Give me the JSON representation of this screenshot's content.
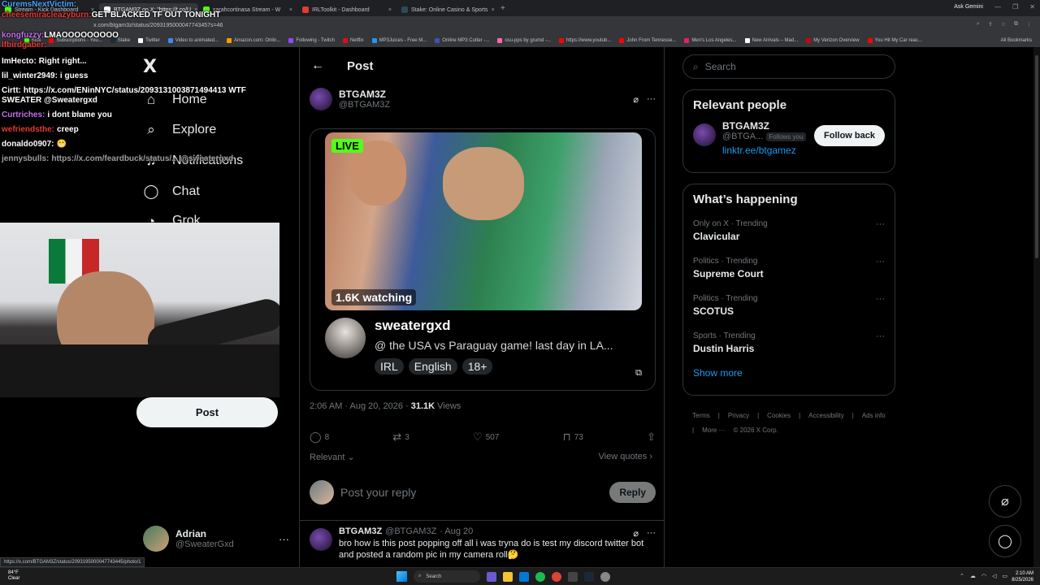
{
  "browser": {
    "tabs": [
      {
        "label": "Stream - Kick Dashboard",
        "color": "#53fc18",
        "active": false
      },
      {
        "label": "BTGAM3Z on X: \"https://t.co/U",
        "color": "#ffffff",
        "active": true
      },
      {
        "label": "sarahcortinasa Stream - W",
        "color": "#53fc18",
        "active": false
      },
      {
        "label": "IRLToolkit - Dashboard",
        "color": "#e53935",
        "active": false
      },
      {
        "label": "Stake: Online Casino & Sports",
        "color": "#1a2c38",
        "active": false
      }
    ],
    "new_tab": "+",
    "ask_gemini": "Ask Gemini",
    "url": "x.com/btgam3z/status/2093195000047743457s=46",
    "bookmarks": [
      {
        "label": "Kick",
        "color": "#53fc18"
      },
      {
        "label": "Subscriptions - You...",
        "color": "#ff0000"
      },
      {
        "label": "Stake",
        "color": "#1a2c38"
      },
      {
        "label": "Twitter",
        "color": "#ffffff"
      },
      {
        "label": "Video to animated...",
        "color": "#4285f4"
      },
      {
        "label": "Amazon.com: Onlin...",
        "color": "#ff9900"
      },
      {
        "label": "Following - Twitch",
        "color": "#9146ff"
      },
      {
        "label": "Netflix",
        "color": "#e50914"
      },
      {
        "label": "MP3Juices - Free M...",
        "color": "#2196f3"
      },
      {
        "label": "Online MP3 Cutter -...",
        "color": "#3f51b5"
      },
      {
        "label": "osu-pps by grumd -...",
        "color": "#ff66aa"
      },
      {
        "label": "https://www.youtub...",
        "color": "#ff0000"
      },
      {
        "label": "John From Tennesse...",
        "color": "#ff0000"
      },
      {
        "label": "Men's Los Angeles...",
        "color": "#e91e63"
      },
      {
        "label": "New Arrivals – Mad...",
        "color": "#ffffff"
      },
      {
        "label": "My Verizon Overview",
        "color": "#cd040b"
      },
      {
        "label": "You Hit My Car reac...",
        "color": "#ff0000"
      }
    ],
    "all_bookmarks": "All Bookmarks",
    "status_url": "https://x.com/BTGAM3Z/status/2093195000047743445/photo/1"
  },
  "nav": {
    "logo": "X",
    "items": [
      {
        "label": "Home",
        "icon": "home-icon",
        "glyph": "⌂"
      },
      {
        "label": "Explore",
        "icon": "search-icon",
        "glyph": "⌕"
      },
      {
        "label": "Notifications",
        "icon": "bell-icon",
        "glyph": "♫"
      },
      {
        "label": "Chat",
        "icon": "chat-icon",
        "glyph": "◯"
      },
      {
        "label": "Grok",
        "icon": "grok-icon",
        "glyph": "◔"
      }
    ],
    "post_button": "Post",
    "account": {
      "name": "Adrian",
      "handle": "@SweaterGxd",
      "more": "···"
    }
  },
  "post": {
    "header": "Post",
    "back": "←",
    "author": {
      "name": "BTGAM3Z",
      "handle": "@BTGAM3Z",
      "more": "···"
    },
    "card": {
      "live": "LIVE",
      "watching": "1.6K watching",
      "streamer": "sweatergxd",
      "title": "@ the USA vs Paraguay game! last day in LA...",
      "tags": [
        "IRL",
        "English",
        "18+"
      ]
    },
    "meta": {
      "time": "2:06 AM · Aug 20, 2026 · ",
      "views_count": "31.1K",
      "views_label": " Views"
    },
    "stats": {
      "replies": "8",
      "reposts": "3",
      "likes": "507",
      "bookmarks": "73"
    },
    "sort": "Relevant ⌄",
    "view_quotes": "View quotes ›",
    "reply_placeholder": "Post your reply",
    "reply_button": "Reply",
    "reply_post": {
      "name": "BTGAM3Z",
      "handle": "@BTGAM3Z",
      "date": "· Aug 20",
      "text": "bro how is this post popping off all i was tryna do is test my discord twitter bot and posted a random pic in my camera roll🤔"
    }
  },
  "sidebar": {
    "search_placeholder": "Search",
    "relevant": {
      "title": "Relevant people",
      "name": "BTGAM3Z",
      "handle": "@BTGA...",
      "follows_you": "Follows you",
      "link": "linktr.ee/btgamez",
      "button": "Follow back"
    },
    "happening": {
      "title": "What’s happening",
      "trends": [
        {
          "context": "Only on X · Trending",
          "topic": "Clavicular"
        },
        {
          "context": "Politics · Trending",
          "topic": "Supreme Court"
        },
        {
          "context": "Politics · Trending",
          "topic": "SCOTUS"
        },
        {
          "context": "Sports · Trending",
          "topic": "Dustin Harris"
        }
      ],
      "show_more": "Show more"
    },
    "footer": [
      "Terms",
      "|",
      "Privacy",
      "|",
      "Cookies",
      "|",
      "Accessibility",
      "|",
      "Ads info",
      "|",
      "More ···",
      "© 2026 X Corp."
    ]
  },
  "chat_overlay": {
    "top_lines": [
      {
        "user": "CuremsNextVictim:",
        "text": "",
        "color": "#4aa3ff"
      },
      {
        "user": "cheesemiracleazyburn:",
        "text": "GET BLACKED TF OUT TONIGHT",
        "color": "#e53935"
      },
      {
        "user": "",
        "text": "",
        "color": "#ffffff"
      },
      {
        "user": "kongfuzzy:",
        "text": "LMAOOOOOOOOO",
        "color": "#c471ed"
      },
      {
        "user": "lfbirdgaber:",
        "text": "",
        "color": "#e53935"
      }
    ],
    "messages": [
      {
        "user": "ImHecto:",
        "text": "Right right...",
        "color": "#ffffff"
      },
      {
        "user": "lil_winter2949:",
        "text": "i guess",
        "color": "#ffffff"
      },
      {
        "user": "Cirtt:",
        "text": "https://x.com/ENinNYC/status/2093131003871494413 WTF SWEATER @Sweatergxd",
        "color": "#ffffff"
      },
      {
        "user": "Curtriches:",
        "text": "i dont blame you",
        "color": "#c471ed"
      },
      {
        "user": "wefriendsthe:",
        "text": "creep",
        "color": "#e53935"
      },
      {
        "user": "donaldo0907:",
        "text": "😬",
        "color": "#ffffff"
      },
      {
        "user": "jennysbulls:",
        "text": "https://x.com/feardbuck/status/... @sweatergxd",
        "color": "#9e9e9e"
      }
    ]
  },
  "taskbar": {
    "weather_temp": "84°F",
    "weather_desc": "Clear",
    "search": "Search",
    "time": "2:10 AM",
    "date": "8/25/2026"
  }
}
